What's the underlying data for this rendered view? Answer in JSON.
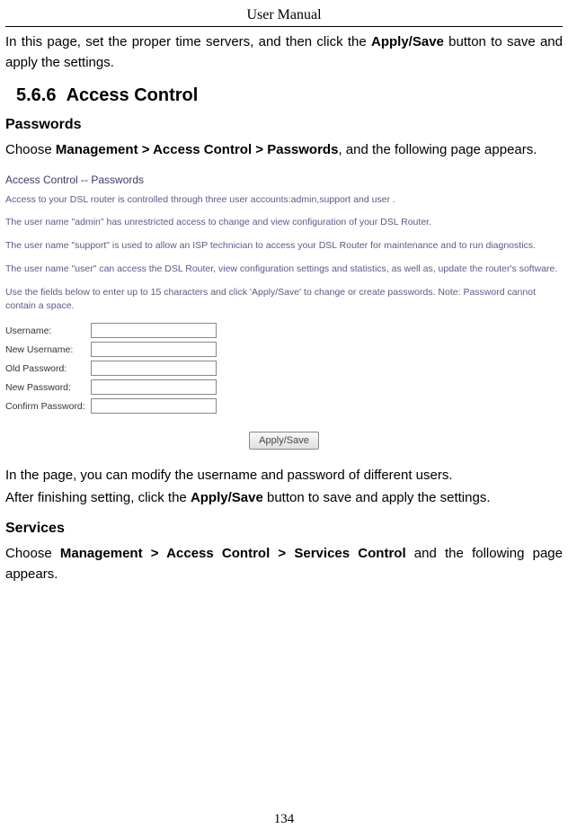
{
  "header": {
    "title": "User Manual"
  },
  "intro": {
    "prefix": "In this page, set the proper time servers, and then click the ",
    "bold": "Apply/Save",
    "suffix": " button to save and apply the settings."
  },
  "section": {
    "number": "5.6.6",
    "title": "Access Control"
  },
  "passwords": {
    "heading": "Passwords",
    "intro_prefix": "Choose ",
    "intro_bold": "Management > Access Control > Passwords",
    "intro_suffix": ", and the following page appears.",
    "screenshot": {
      "title": "Access Control -- Passwords",
      "p1": "Access to your DSL router is controlled through three user accounts:admin,support and user .",
      "p2": "The user name \"admin\" has unrestricted access to change and view configuration of your DSL Router.",
      "p3": "The user name \"support\" is used to allow an ISP technician to access your DSL Router for maintenance and to run diagnostics.",
      "p4": "The user name \"user\" can access the DSL Router, view configuration settings and statistics, as well as, update the router's software.",
      "p5": "Use the fields below to enter up to 15 characters and click 'Apply/Save' to change or create passwords. Note: Password cannot contain a space.",
      "fields": {
        "username": "Username:",
        "new_username": "New Username:",
        "old_password": "Old Password:",
        "new_password": "New Password:",
        "confirm_password": "Confirm Password:"
      },
      "button": "Apply/Save"
    },
    "after1": "In the page, you can modify the username and password of different users.",
    "after2_prefix": "After finishing setting, click the ",
    "after2_bold": "Apply/Save",
    "after2_suffix": " button to save and apply the settings."
  },
  "services": {
    "heading": "Services",
    "intro_prefix": "Choose ",
    "intro_bold": "Management > Access Control > Services Control",
    "intro_suffix": " and the following page appears."
  },
  "page_number": "134"
}
